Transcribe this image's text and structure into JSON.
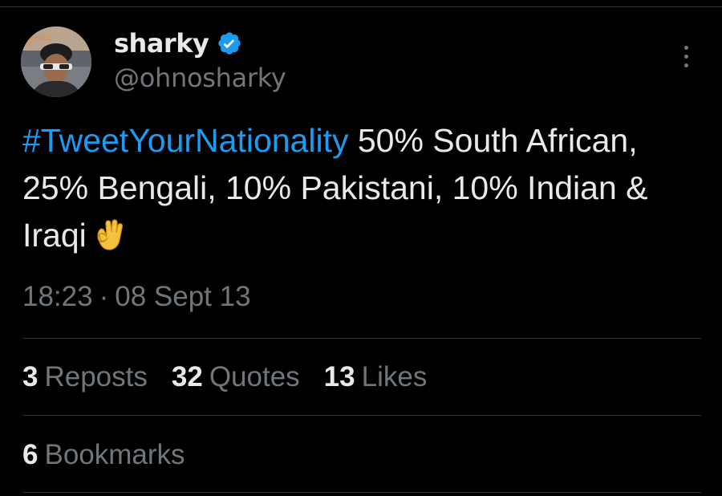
{
  "colors": {
    "background": "#000000",
    "text_primary": "#e7e9ea",
    "text_secondary": "#71767b",
    "hashtag": "#1d9bf0",
    "verified": "#1d9bf0",
    "divider": "#2f3336"
  },
  "author": {
    "display_name": "sharky",
    "handle": "@ohnosharky",
    "verified_icon": "verified-badge-icon",
    "avatar": "profile-avatar"
  },
  "tweet": {
    "hashtag": "#TweetYourNationality",
    "text_after_hashtag": " 50% South African, 25% Bengali, 10% Pakistani, 10% Indian & Iraqi",
    "emoji": "ok-hand-emoji"
  },
  "meta": {
    "time": "18:23",
    "separator": "·",
    "date": "08 Sept 13"
  },
  "stats": {
    "reposts": {
      "count": "3",
      "label": "Reposts"
    },
    "quotes": {
      "count": "32",
      "label": "Quotes"
    },
    "likes": {
      "count": "13",
      "label": "Likes"
    },
    "bookmarks": {
      "count": "6",
      "label": "Bookmarks"
    }
  },
  "more_icon": "more-options-icon"
}
